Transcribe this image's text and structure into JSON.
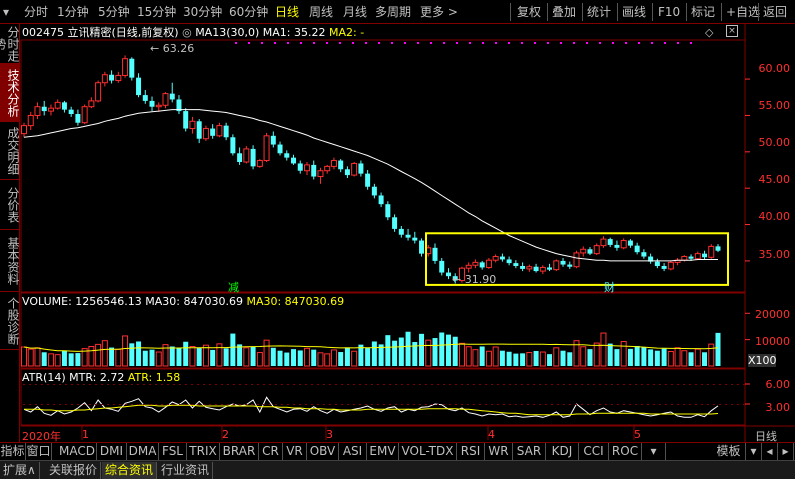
{
  "toolbar": {
    "left_items": [
      "分时",
      "1分钟",
      "5分钟",
      "15分钟",
      "30分钟",
      "60分钟",
      "日线",
      "周线",
      "月线",
      "多周期",
      "更多 >"
    ],
    "active_item": "日线",
    "right_items": [
      "复权",
      "叠加",
      "统计",
      "画线",
      "F10",
      "标记",
      "+自选",
      "返回"
    ]
  },
  "side_tabs": [
    "分时走势",
    "技术分析",
    "成交明细",
    "分价表",
    "基本资料",
    "个股诊断"
  ],
  "side_tab_active": "技术分析",
  "main_info": {
    "stock": "002475 立讯精密(日线,前复权)",
    "ma13": "MA13(30,0)",
    "ma1": "MA1: 35.22",
    "ma2": "MA2: -",
    "high_label": "63.26",
    "low_label": "31.90",
    "mark_jian": "减",
    "mark_cai": "财"
  },
  "price_axis": [
    "60.00",
    "55.00",
    "50.00",
    "45.00",
    "40.00",
    "35.00"
  ],
  "volume_info": {
    "volume": "VOLUME: 1256546.13",
    "ma30": "MA30: 847030.69",
    "ma30b": "MA30: 847030.69"
  },
  "volume_axis": [
    "20000",
    "10000"
  ],
  "volume_unit": "X100",
  "atr_info": {
    "name": "ATR(14)",
    "mtr": "MTR: 2.72",
    "atr": "ATR: 1.58"
  },
  "atr_axis": [
    "6.00",
    "3.00"
  ],
  "date_axis": {
    "year": "2020年",
    "months": [
      "1",
      "2",
      "3",
      "4",
      "5"
    ],
    "period": "日线"
  },
  "indicator_tabs": [
    "指标",
    "窗口",
    "MACD",
    "DMI",
    "DMA",
    "FSL",
    "TRIX",
    "BRAR",
    "CR",
    "VR",
    "OBV",
    "ASI",
    "EMV",
    "VOL-TDX",
    "RSI",
    "WR",
    "SAR",
    "KDJ",
    "CCI",
    "ROC"
  ],
  "indicator_right": "模板",
  "status_tabs": [
    "扩展∧",
    "关联报价",
    "综合资讯",
    "行业资讯"
  ],
  "status_active": "综合资讯",
  "colors": {
    "up": "#ff3030",
    "down": "#54ffff",
    "ma": "#ffffff",
    "highlight": "#ffff00",
    "border": "#800000"
  },
  "chart_data": {
    "type": "candlestick",
    "price_range": [
      31,
      64
    ],
    "candles": [
      [
        52.5,
        54.0,
        52.0,
        53.6
      ],
      [
        53.6,
        55.5,
        53.0,
        55.0
      ],
      [
        55.0,
        56.8,
        54.5,
        56.2
      ],
      [
        56.2,
        57.0,
        55.0,
        55.6
      ],
      [
        55.6,
        56.5,
        55.0,
        56.0
      ],
      [
        56.0,
        57.2,
        55.8,
        56.8
      ],
      [
        56.8,
        57.0,
        55.4,
        55.8
      ],
      [
        55.8,
        56.2,
        54.8,
        55.2
      ],
      [
        55.2,
        55.8,
        53.6,
        54.0
      ],
      [
        54.0,
        56.5,
        53.8,
        56.2
      ],
      [
        56.2,
        57.5,
        56.0,
        57.0
      ],
      [
        57.0,
        59.8,
        56.8,
        59.5
      ],
      [
        59.5,
        61.0,
        59.0,
        60.6
      ],
      [
        60.6,
        61.2,
        59.4,
        59.8
      ],
      [
        59.8,
        61.0,
        59.5,
        60.5
      ],
      [
        60.5,
        63.26,
        60.2,
        62.8
      ],
      [
        62.8,
        63.0,
        59.8,
        60.2
      ],
      [
        60.2,
        60.8,
        57.5,
        57.8
      ],
      [
        57.8,
        58.5,
        56.6,
        57.0
      ],
      [
        57.0,
        57.6,
        55.6,
        56.2
      ],
      [
        56.2,
        56.8,
        55.5,
        56.4
      ],
      [
        56.4,
        58.2,
        56.0,
        58.0
      ],
      [
        58.0,
        59.5,
        56.8,
        57.2
      ],
      [
        57.2,
        57.8,
        55.2,
        55.6
      ],
      [
        55.6,
        56.0,
        52.8,
        53.2
      ],
      [
        53.2,
        54.8,
        52.5,
        54.2
      ],
      [
        54.2,
        54.5,
        51.2,
        51.8
      ],
      [
        51.8,
        53.6,
        51.5,
        53.2
      ],
      [
        53.2,
        53.8,
        51.8,
        52.2
      ],
      [
        52.2,
        54.0,
        52.0,
        53.6
      ],
      [
        53.6,
        54.0,
        51.6,
        52.0
      ],
      [
        52.0,
        52.4,
        49.5,
        49.8
      ],
      [
        49.8,
        50.6,
        48.2,
        48.6
      ],
      [
        48.6,
        50.8,
        48.4,
        50.4
      ],
      [
        50.4,
        50.9,
        47.6,
        48.0
      ],
      [
        48.0,
        49.0,
        47.8,
        48.8
      ],
      [
        48.8,
        52.6,
        48.6,
        52.2
      ],
      [
        52.2,
        52.8,
        50.6,
        51.0
      ],
      [
        51.0,
        51.4,
        49.5,
        49.8
      ],
      [
        49.8,
        50.2,
        48.8,
        49.2
      ],
      [
        49.2,
        49.6,
        48.2,
        48.4
      ],
      [
        48.4,
        48.8,
        47.0,
        47.4
      ],
      [
        47.4,
        48.6,
        46.8,
        48.2
      ],
      [
        48.2,
        48.8,
        46.2,
        46.6
      ],
      [
        46.6,
        47.8,
        45.6,
        47.4
      ],
      [
        47.4,
        48.2,
        47.0,
        48.0
      ],
      [
        48.0,
        49.2,
        47.6,
        48.8
      ],
      [
        48.8,
        49.0,
        47.2,
        47.6
      ],
      [
        47.6,
        48.0,
        46.4,
        46.8
      ],
      [
        46.8,
        48.6,
        46.6,
        48.4
      ],
      [
        48.4,
        48.8,
        46.6,
        47.0
      ],
      [
        47.0,
        47.5,
        44.8,
        45.2
      ],
      [
        45.2,
        45.6,
        43.6,
        44.0
      ],
      [
        44.0,
        44.4,
        42.4,
        42.8
      ],
      [
        42.8,
        43.2,
        40.6,
        41.0
      ],
      [
        41.0,
        41.4,
        39.0,
        39.4
      ],
      [
        39.4,
        39.8,
        38.2,
        38.6
      ],
      [
        38.6,
        39.4,
        37.8,
        38.2
      ],
      [
        38.2,
        39.0,
        37.4,
        37.8
      ],
      [
        37.8,
        38.1,
        35.6,
        36.0
      ],
      [
        36.0,
        37.2,
        35.6,
        36.8
      ],
      [
        36.8,
        37.4,
        34.6,
        35.0
      ],
      [
        35.0,
        35.4,
        33.0,
        33.4
      ],
      [
        33.4,
        34.0,
        32.5,
        32.9
      ],
      [
        32.9,
        33.3,
        31.9,
        32.3
      ],
      [
        32.3,
        34.2,
        32.0,
        34.0
      ],
      [
        34.0,
        34.8,
        33.4,
        34.4
      ],
      [
        34.4,
        35.2,
        34.0,
        34.8
      ],
      [
        34.8,
        35.0,
        33.8,
        34.1
      ],
      [
        34.1,
        35.4,
        33.9,
        35.1
      ],
      [
        35.1,
        35.9,
        34.8,
        35.6
      ],
      [
        35.6,
        36.0,
        34.9,
        35.2
      ],
      [
        35.2,
        35.6,
        34.4,
        34.7
      ],
      [
        34.7,
        35.1,
        34.0,
        34.3
      ],
      [
        34.3,
        34.8,
        33.6,
        33.9
      ],
      [
        33.9,
        34.5,
        33.5,
        34.2
      ],
      [
        34.2,
        34.6,
        33.4,
        33.6
      ],
      [
        33.6,
        34.4,
        33.2,
        34.1
      ],
      [
        34.1,
        34.6,
        33.6,
        33.8
      ],
      [
        33.8,
        35.2,
        33.6,
        35.0
      ],
      [
        35.0,
        35.4,
        34.2,
        34.5
      ],
      [
        34.5,
        34.9,
        33.9,
        34.2
      ],
      [
        34.2,
        36.4,
        34.0,
        36.1
      ],
      [
        36.1,
        37.0,
        35.6,
        36.6
      ],
      [
        36.6,
        36.9,
        35.8,
        36.0
      ],
      [
        36.0,
        37.4,
        35.8,
        37.1
      ],
      [
        37.1,
        38.4,
        36.8,
        38.0
      ],
      [
        38.0,
        38.2,
        36.9,
        37.2
      ],
      [
        37.2,
        37.8,
        36.4,
        36.8
      ],
      [
        36.8,
        38.1,
        36.6,
        37.8
      ],
      [
        37.8,
        38.0,
        36.8,
        37.1
      ],
      [
        37.1,
        37.5,
        35.9,
        36.2
      ],
      [
        36.2,
        36.6,
        35.3,
        35.6
      ],
      [
        35.6,
        36.0,
        34.6,
        34.9
      ],
      [
        34.9,
        35.3,
        34.0,
        34.3
      ],
      [
        34.3,
        34.7,
        33.6,
        33.9
      ],
      [
        33.9,
        35.0,
        33.7,
        34.8
      ],
      [
        34.8,
        35.4,
        34.4,
        35.1
      ],
      [
        35.1,
        35.8,
        34.9,
        35.6
      ],
      [
        35.6,
        35.9,
        35.0,
        35.3
      ],
      [
        35.3,
        36.3,
        35.1,
        36.0
      ],
      [
        36.0,
        36.4,
        35.2,
        35.5
      ],
      [
        35.5,
        37.3,
        35.3,
        37.0
      ],
      [
        37.0,
        37.3,
        36.2,
        36.4
      ]
    ],
    "ma30": [
      52.0,
      52.1,
      52.2,
      52.4,
      52.6,
      52.8,
      53.0,
      53.2,
      53.3,
      53.5,
      53.7,
      53.9,
      54.2,
      54.4,
      54.6,
      54.9,
      55.1,
      55.3,
      55.4,
      55.5,
      55.6,
      55.7,
      55.8,
      55.8,
      55.8,
      55.8,
      55.8,
      55.7,
      55.6,
      55.5,
      55.4,
      55.2,
      55.0,
      54.8,
      54.6,
      54.3,
      54.1,
      53.8,
      53.5,
      53.2,
      52.9,
      52.6,
      52.3,
      51.9,
      51.6,
      51.3,
      51.0,
      50.7,
      50.4,
      50.1,
      49.8,
      49.5,
      49.1,
      48.7,
      48.3,
      47.8,
      47.3,
      46.8,
      46.3,
      45.8,
      45.2,
      44.6,
      44.0,
      43.4,
      42.8,
      42.2,
      41.6,
      41.1,
      40.5,
      40.0,
      39.5,
      39.0,
      38.5,
      38.1,
      37.7,
      37.3,
      36.9,
      36.6,
      36.3,
      36.0,
      35.8,
      35.6,
      35.4,
      35.3,
      35.2,
      35.1,
      35.1,
      35.0,
      35.0,
      35.0,
      35.0,
      35.0,
      35.0,
      35.0,
      35.0,
      35.0,
      35.0,
      35.1,
      35.1,
      35.1,
      35.2,
      35.2,
      35.2,
      35.2
    ],
    "volume": [
      7200,
      6400,
      6900,
      5200,
      4600,
      4300,
      5700,
      4800,
      4900,
      6600,
      7400,
      8200,
      9600,
      7000,
      6300,
      11400,
      8600,
      9300,
      5800,
      6200,
      5300,
      8100,
      7400,
      6900,
      9200,
      7400,
      6800,
      7900,
      6100,
      8400,
      6700,
      12300,
      8200,
      6900,
      7400,
      5100,
      9800,
      6900,
      5800,
      5100,
      6400,
      5900,
      6700,
      6200,
      5000,
      4600,
      6100,
      5300,
      6900,
      5600,
      8100,
      6800,
      9300,
      8200,
      11700,
      9600,
      10800,
      13000,
      9100,
      12200,
      9800,
      10600,
      12700,
      11900,
      11100,
      8600,
      7300,
      6200,
      7400,
      5600,
      7200,
      5800,
      5400,
      4700,
      4800,
      5100,
      5700,
      5300,
      4500,
      6900,
      5800,
      5200,
      9600,
      7300,
      6400,
      8700,
      12500,
      8500,
      6400,
      9300,
      6500,
      7600,
      7200,
      6300,
      5800,
      6600,
      5500,
      6900,
      5800,
      5200,
      6400,
      5200,
      8300,
      12566
    ],
    "mtr": [
      2.2,
      1.8,
      2.6,
      1.6,
      1.3,
      2.0,
      1.5,
      1.8,
      2.4,
      3.2,
      2.0,
      3.6,
      2.4,
      2.2,
      1.9,
      3.1,
      3.4,
      3.8,
      2.6,
      2.4,
      1.8,
      2.5,
      3.3,
      2.9,
      3.6,
      2.4,
      3.4,
      2.5,
      2.3,
      2.1,
      2.6,
      3.0,
      2.7,
      2.9,
      3.6,
      1.8,
      4.0,
      2.6,
      2.2,
      1.8,
      2.2,
      2.3,
      1.9,
      2.6,
      2.0,
      1.6,
      2.2,
      1.8,
      2.0,
      2.2,
      2.4,
      2.7,
      2.2,
      1.9,
      2.4,
      2.6,
      1.8,
      2.2,
      2.0,
      2.5,
      2.6,
      3.0,
      2.9,
      2.2,
      2.0,
      2.4,
      1.7,
      1.5,
      1.2,
      1.5,
      1.4,
      1.5,
      1.1,
      1.2,
      1.0,
      1.1,
      1.2,
      1.0,
      1.3,
      1.8,
      1.0,
      1.2,
      3.0,
      2.2,
      1.4,
      2.0,
      2.4,
      1.8,
      1.6,
      2.0,
      1.8,
      1.6,
      1.4,
      1.2,
      1.4,
      1.6,
      1.8,
      1.2,
      1.0,
      1.0,
      1.4,
      1.1,
      2.0,
      2.72
    ],
    "atr": [
      2.2,
      2.2,
      2.2,
      2.1,
      2.1,
      2.0,
      2.0,
      2.0,
      2.1,
      2.1,
      2.2,
      2.3,
      2.4,
      2.4,
      2.5,
      2.6,
      2.7,
      2.8,
      2.8,
      2.8,
      2.7,
      2.7,
      2.8,
      2.8,
      2.8,
      2.8,
      2.7,
      2.7,
      2.7,
      2.7,
      2.7,
      2.7,
      2.7,
      2.7,
      2.7,
      2.6,
      2.6,
      2.6,
      2.5,
      2.5,
      2.4,
      2.4,
      2.3,
      2.3,
      2.3,
      2.2,
      2.2,
      2.1,
      2.1,
      2.1,
      2.1,
      2.2,
      2.2,
      2.2,
      2.2,
      2.2,
      2.2,
      2.2,
      2.2,
      2.2,
      2.3,
      2.3,
      2.3,
      2.3,
      2.3,
      2.2,
      2.2,
      2.1,
      2.0,
      1.9,
      1.8,
      1.7,
      1.6,
      1.6,
      1.5,
      1.4,
      1.4,
      1.4,
      1.4,
      1.4,
      1.4,
      1.4,
      1.5,
      1.5,
      1.5,
      1.6,
      1.6,
      1.6,
      1.6,
      1.6,
      1.6,
      1.6,
      1.6,
      1.5,
      1.5,
      1.5,
      1.5,
      1.5,
      1.5,
      1.5,
      1.5,
      1.5,
      1.5,
      1.58
    ]
  }
}
